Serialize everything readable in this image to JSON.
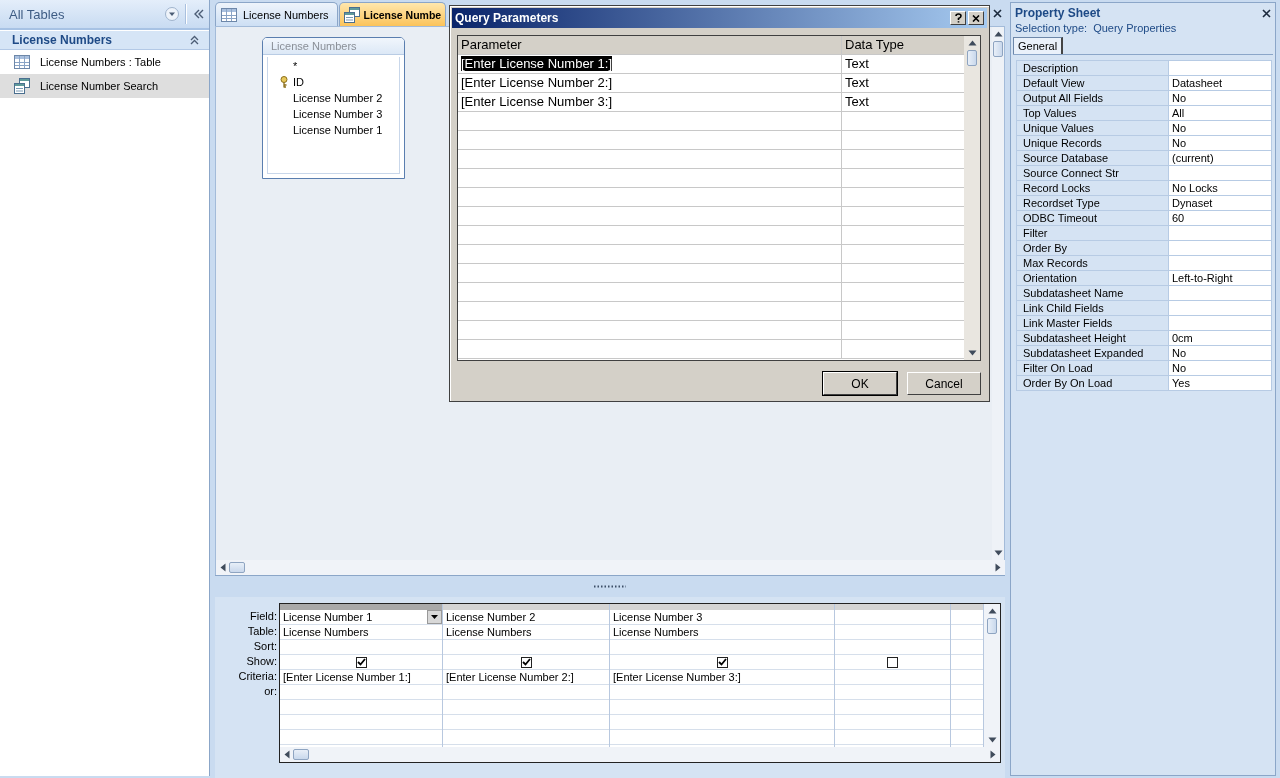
{
  "nav_pane": {
    "title": "All Tables",
    "group": {
      "title": "License Numbers",
      "expanded": true,
      "items": [
        {
          "label": "License Numbers : Table",
          "kind": "table",
          "selected": false
        },
        {
          "label": "License Number Search",
          "kind": "query",
          "selected": true
        }
      ]
    }
  },
  "tabs": [
    {
      "label": "License Numbers",
      "kind": "table",
      "selected": false
    },
    {
      "label": "License Numbe",
      "kind": "query",
      "selected": true
    }
  ],
  "field_list": {
    "title": "License Numbers",
    "fields": [
      {
        "name": "*",
        "primary_key": false
      },
      {
        "name": "ID",
        "primary_key": true
      },
      {
        "name": "License Number 2",
        "primary_key": false
      },
      {
        "name": "License Number 3",
        "primary_key": false
      },
      {
        "name": "License Number 1",
        "primary_key": false
      }
    ]
  },
  "design_grid": {
    "row_labels": [
      "Field:",
      "Table:",
      "Sort:",
      "Show:",
      "Criteria:",
      "or:"
    ],
    "columns": [
      {
        "field": "License Number 1",
        "table": "License Numbers",
        "show": true,
        "criteria": "[Enter License Number 1:]",
        "selected": true
      },
      {
        "field": "License Number 2",
        "table": "License Numbers",
        "show": true,
        "criteria": "[Enter License Number 2:]",
        "selected": false
      },
      {
        "field": "License Number 3",
        "table": "License Numbers",
        "show": true,
        "criteria": "[Enter License Number 3:]",
        "selected": false
      },
      {
        "show": false,
        "selected": false
      }
    ]
  },
  "dialog": {
    "title": "Query Parameters",
    "columns": [
      "Parameter",
      "Data Type"
    ],
    "rows": [
      {
        "parameter": "[Enter License Number 1:]",
        "data_type": "Text",
        "selected": true
      },
      {
        "parameter": "[Enter License Number 2:]",
        "data_type": "Text",
        "selected": false
      },
      {
        "parameter": "[Enter License Number 3:]",
        "data_type": "Text",
        "selected": false
      }
    ],
    "buttons": [
      {
        "label": "OK",
        "default": true
      },
      {
        "label": "Cancel",
        "default": false
      }
    ]
  },
  "property_sheet": {
    "title": "Property Sheet",
    "selection_type_label": "Selection type:",
    "selection_type": "Query Properties",
    "tabs": [
      {
        "label": "General",
        "selected": true
      }
    ],
    "properties": [
      {
        "name": "Description"
      },
      {
        "name": "Default View",
        "value": "Datasheet"
      },
      {
        "name": "Output All Fields",
        "value": "No"
      },
      {
        "name": "Top Values",
        "value": "All"
      },
      {
        "name": "Unique Values",
        "value": "No"
      },
      {
        "name": "Unique Records",
        "value": "No"
      },
      {
        "name": "Source Database",
        "value": "(current)"
      },
      {
        "name": "Source Connect Str"
      },
      {
        "name": "Record Locks",
        "value": "No Locks"
      },
      {
        "name": "Recordset Type",
        "value": "Dynaset"
      },
      {
        "name": "ODBC Timeout",
        "value": "60"
      },
      {
        "name": "Filter"
      },
      {
        "name": "Order By"
      },
      {
        "name": "Max Records"
      },
      {
        "name": "Orientation",
        "value": "Left-to-Right"
      },
      {
        "name": "Subdatasheet Name"
      },
      {
        "name": "Link Child Fields"
      },
      {
        "name": "Link Master Fields"
      },
      {
        "name": "Subdatasheet Height",
        "value": "0cm"
      },
      {
        "name": "Subdatasheet Expanded",
        "value": "No"
      },
      {
        "name": "Filter On Load",
        "value": "No"
      },
      {
        "name": "Order By On Load",
        "value": "Yes"
      }
    ]
  }
}
